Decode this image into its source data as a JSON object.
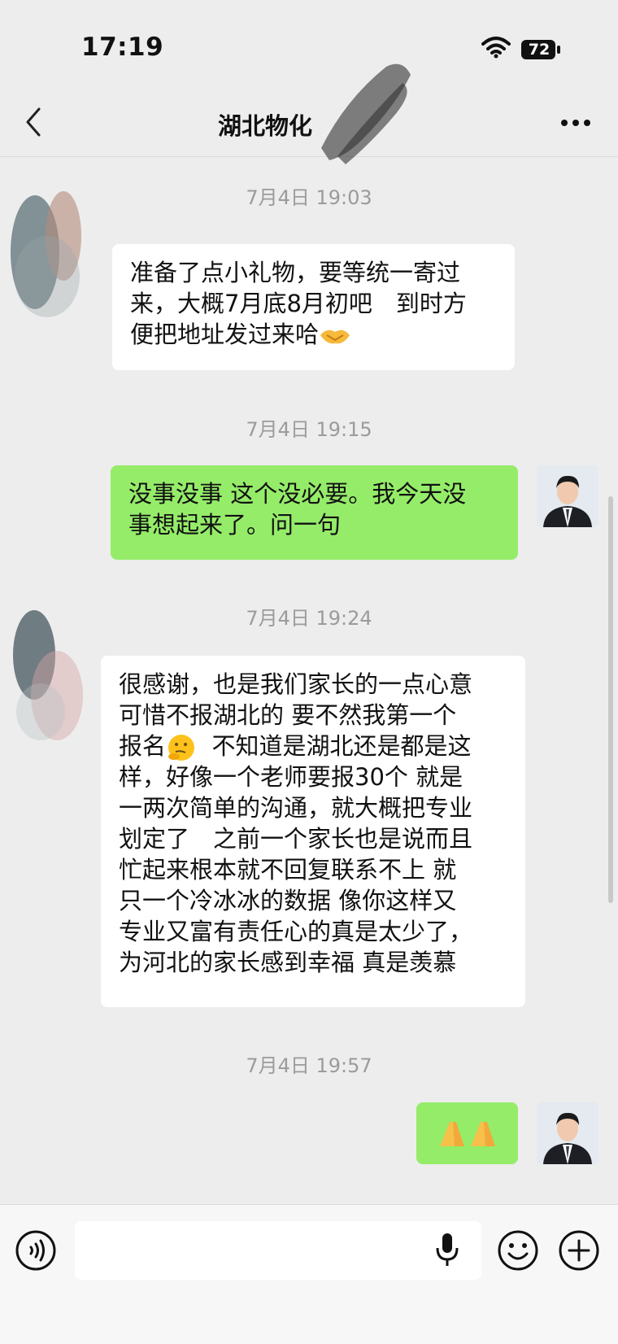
{
  "status_bar": {
    "time": "17:19",
    "battery": "72"
  },
  "nav": {
    "title": "湖北物化"
  },
  "messages": [
    {
      "timestamp": "7月4日 19:03",
      "side": "left",
      "lines": [
        "准备了点小礼物，要等统一寄过",
        "来，大概7月底8月初吧　到时方",
        "便把地址发过来哈"
      ]
    },
    {
      "timestamp": "7月4日 19:15",
      "side": "right",
      "lines": [
        "没事没事 这个没必要。我今天没",
        "事想起来了。问一句"
      ]
    },
    {
      "timestamp": "7月4日 19:24",
      "side": "left",
      "lines": [
        "很感谢，也是我们家长的一点心意",
        "可惜不报湖北的 要不然我第一个",
        "报名",
        "不知道是湖北还是都是这",
        "样，好像一个老师要报30个  就是",
        "一两次简单的沟通，就大概把专业",
        "划定了　之前一个家长也是说而且",
        "忙起来根本就不回复联系不上 就",
        "只一个冷冰冰的数据  像你这样又",
        "专业又富有责任心的真是太少了，",
        "为河北的家长感到幸福 真是羡慕"
      ]
    },
    {
      "timestamp": "7月4日 19:57",
      "side": "right",
      "lines": []
    }
  ],
  "icons": {
    "handshake": "handshake-emoji",
    "thinking": "thinking-face-emoji",
    "pray": "folded-hands-emoji"
  },
  "colors": {
    "sent_bubble": "#95ec69",
    "received_bubble": "#ffffff",
    "background": "#ededed"
  }
}
